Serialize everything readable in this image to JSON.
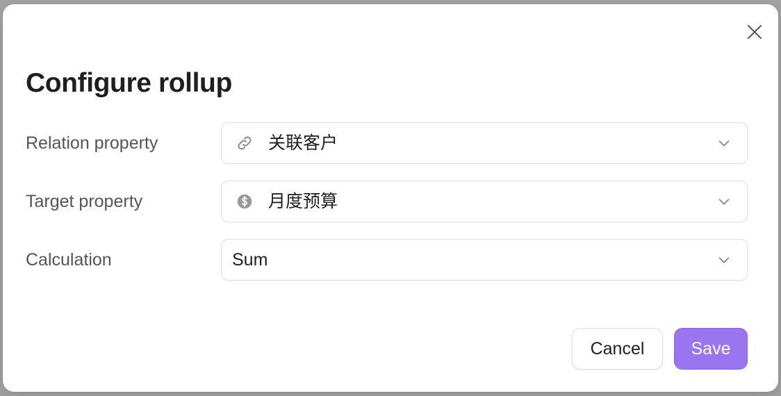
{
  "dialog": {
    "title": "Configure rollup",
    "close_icon": "close-icon"
  },
  "fields": {
    "relation": {
      "label": "Relation property",
      "icon": "link-icon",
      "value": "关联客户"
    },
    "target": {
      "label": "Target property",
      "icon": "dollar-circle-icon",
      "value": "月度预算"
    },
    "calculation": {
      "label": "Calculation",
      "value": "Sum"
    }
  },
  "actions": {
    "cancel_label": "Cancel",
    "save_label": "Save"
  },
  "colors": {
    "accent": "#9b74f0",
    "text": "#1f1f1f",
    "label": "#555555",
    "border": "#dedede"
  }
}
